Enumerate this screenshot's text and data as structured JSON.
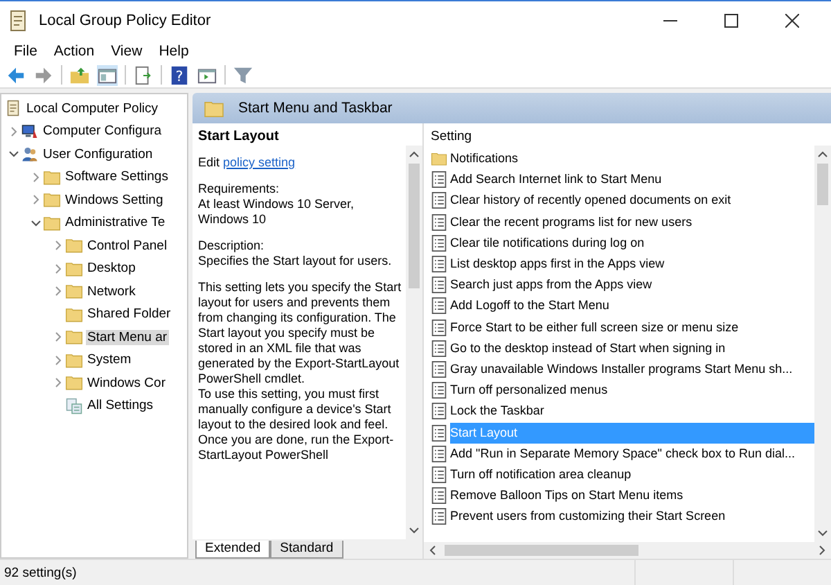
{
  "window": {
    "title": "Local Group Policy Editor"
  },
  "menu": [
    "File",
    "Action",
    "View",
    "Help"
  ],
  "toolbar": {
    "help_glyph": "?"
  },
  "tree": [
    {
      "label": "Local Computer Policy",
      "kind": "policy",
      "selected": false,
      "children": [
        {
          "label": "Computer Configura",
          "kind": "computer",
          "expanded": false,
          "selected": false
        },
        {
          "label": "User Configuration",
          "kind": "user",
          "expanded": true,
          "selected": false,
          "children": [
            {
              "label": "Software Settings",
              "kind": "folder",
              "expanded": false,
              "selected": false
            },
            {
              "label": "Windows Setting",
              "kind": "folder",
              "expanded": false,
              "selected": false
            },
            {
              "label": "Administrative Te",
              "kind": "folder",
              "expanded": true,
              "selected": false,
              "children": [
                {
                  "label": "Control Panel",
                  "kind": "folder",
                  "expanded": false,
                  "selected": false
                },
                {
                  "label": "Desktop",
                  "kind": "folder",
                  "expanded": false,
                  "selected": false
                },
                {
                  "label": "Network",
                  "kind": "folder",
                  "expanded": false,
                  "selected": false
                },
                {
                  "label": "Shared Folder",
                  "kind": "folder",
                  "selected": false
                },
                {
                  "label": "Start Menu ar",
                  "kind": "folder",
                  "expanded": false,
                  "selected": true
                },
                {
                  "label": "System",
                  "kind": "folder",
                  "expanded": false,
                  "selected": false
                },
                {
                  "label": "Windows Cor",
                  "kind": "folder",
                  "expanded": false,
                  "selected": false
                },
                {
                  "label": "All Settings",
                  "kind": "settings",
                  "selected": false
                }
              ]
            }
          ]
        }
      ]
    }
  ],
  "panel": {
    "title": "Start Menu and Taskbar"
  },
  "description": {
    "heading": "Start Layout",
    "edit_prefix": "Edit",
    "edit_link": "policy setting",
    "requirements_label": "Requirements:",
    "requirements": "At least Windows 10 Server, Windows 10",
    "description_label": "Description:",
    "description": "Specifies the Start layout for users.",
    "details": [
      "This setting lets you specify the Start layout for users and prevents them from changing its configuration. The Start layout you specify must be stored in an XML file that was generated by the Export-StartLayout PowerShell cmdlet.",
      "To use this setting, you must first manually configure a device's Start layout to the desired look and feel. Once you are done, run the Export-StartLayout PowerShell"
    ]
  },
  "settings": {
    "column": "Setting",
    "rows": [
      {
        "label": "Notifications",
        "kind": "folder",
        "selected": false
      },
      {
        "label": "Add Search Internet link to Start Menu",
        "kind": "policy",
        "selected": false
      },
      {
        "label": "Clear history of recently opened documents on exit",
        "kind": "policy",
        "selected": false
      },
      {
        "label": "Clear the recent programs list for new users",
        "kind": "policy",
        "selected": false
      },
      {
        "label": "Clear tile notifications during log on",
        "kind": "policy",
        "selected": false
      },
      {
        "label": "List desktop apps first in the Apps view",
        "kind": "policy",
        "selected": false
      },
      {
        "label": "Search just apps from the Apps view",
        "kind": "policy",
        "selected": false
      },
      {
        "label": "Add Logoff to the Start Menu",
        "kind": "policy",
        "selected": false
      },
      {
        "label": "Force Start to be either full screen size or menu size",
        "kind": "policy",
        "selected": false
      },
      {
        "label": "Go to the desktop instead of Start when signing in",
        "kind": "policy",
        "selected": false
      },
      {
        "label": "Gray unavailable Windows Installer programs Start Menu sh...",
        "kind": "policy",
        "selected": false
      },
      {
        "label": "Turn off personalized menus",
        "kind": "policy",
        "selected": false
      },
      {
        "label": "Lock the Taskbar",
        "kind": "policy",
        "selected": false
      },
      {
        "label": "Start Layout",
        "kind": "policy",
        "selected": true
      },
      {
        "label": "Add \"Run in Separate Memory Space\" check box to Run dial...",
        "kind": "policy",
        "selected": false
      },
      {
        "label": "Turn off notification area cleanup",
        "kind": "policy",
        "selected": false
      },
      {
        "label": "Remove Balloon Tips on Start Menu items",
        "kind": "policy",
        "selected": false
      },
      {
        "label": "Prevent users from customizing their Start Screen",
        "kind": "policy",
        "selected": false
      }
    ]
  },
  "tabs": [
    {
      "label": "Extended",
      "selected": true
    },
    {
      "label": "Standard",
      "selected": false
    }
  ],
  "status_bar": "92 setting(s)"
}
